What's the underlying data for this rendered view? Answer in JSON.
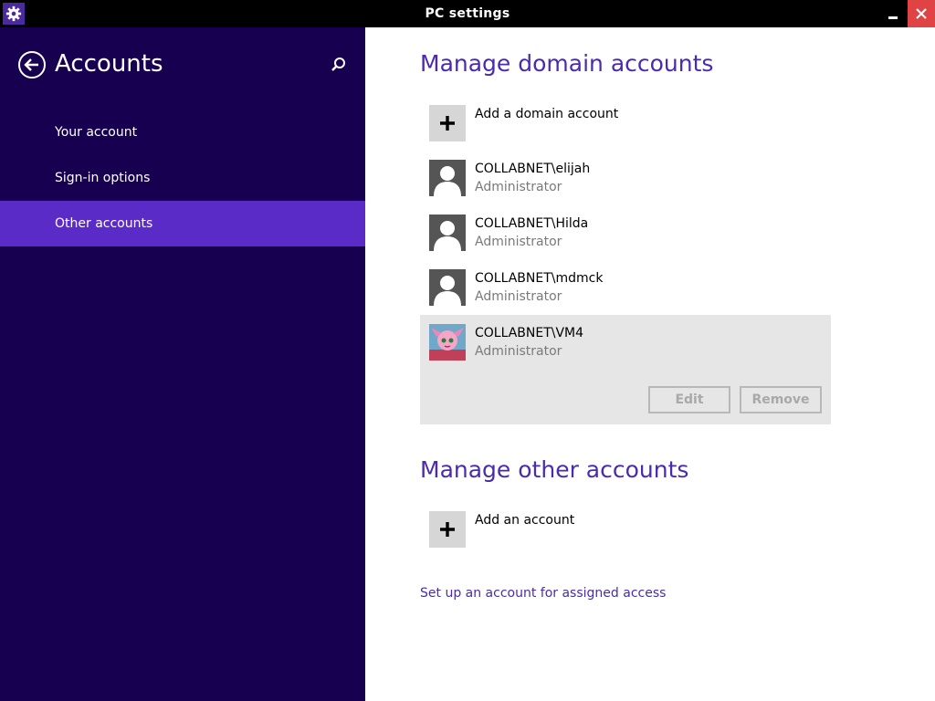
{
  "window": {
    "title": "PC settings",
    "colors": {
      "titlebar": "#000000",
      "close": "#e04343",
      "app_icon_bg": "#4b2aa0"
    }
  },
  "sidebar": {
    "title": "Accounts",
    "colors": {
      "background": "#180050",
      "active": "#5b2bc8"
    },
    "items": [
      {
        "label": "Your account",
        "active": false
      },
      {
        "label": "Sign-in options",
        "active": false
      },
      {
        "label": "Other accounts",
        "active": true
      }
    ]
  },
  "main": {
    "domain_section": {
      "heading": "Manage domain accounts",
      "add_label": "Add a domain account",
      "accounts": [
        {
          "name": "COLLABNET\\elijah",
          "role": "Administrator",
          "avatar": "default-user-icon"
        },
        {
          "name": "COLLABNET\\Hilda",
          "role": "Administrator",
          "avatar": "default-user-icon"
        },
        {
          "name": "COLLABNET\\mdmck",
          "role": "Administrator",
          "avatar": "default-user-icon"
        },
        {
          "name": "COLLABNET\\VM4",
          "role": "Administrator",
          "avatar": "user-photo",
          "selected": true
        }
      ],
      "buttons": {
        "edit": "Edit",
        "remove": "Remove"
      }
    },
    "other_section": {
      "heading": "Manage other accounts",
      "add_label": "Add an account"
    },
    "assigned_access_link": "Set up an account for assigned access",
    "colors": {
      "heading": "#4a2bb0",
      "selected_bg": "#e6e6e6",
      "add_tile": "#d6d6d6"
    }
  }
}
